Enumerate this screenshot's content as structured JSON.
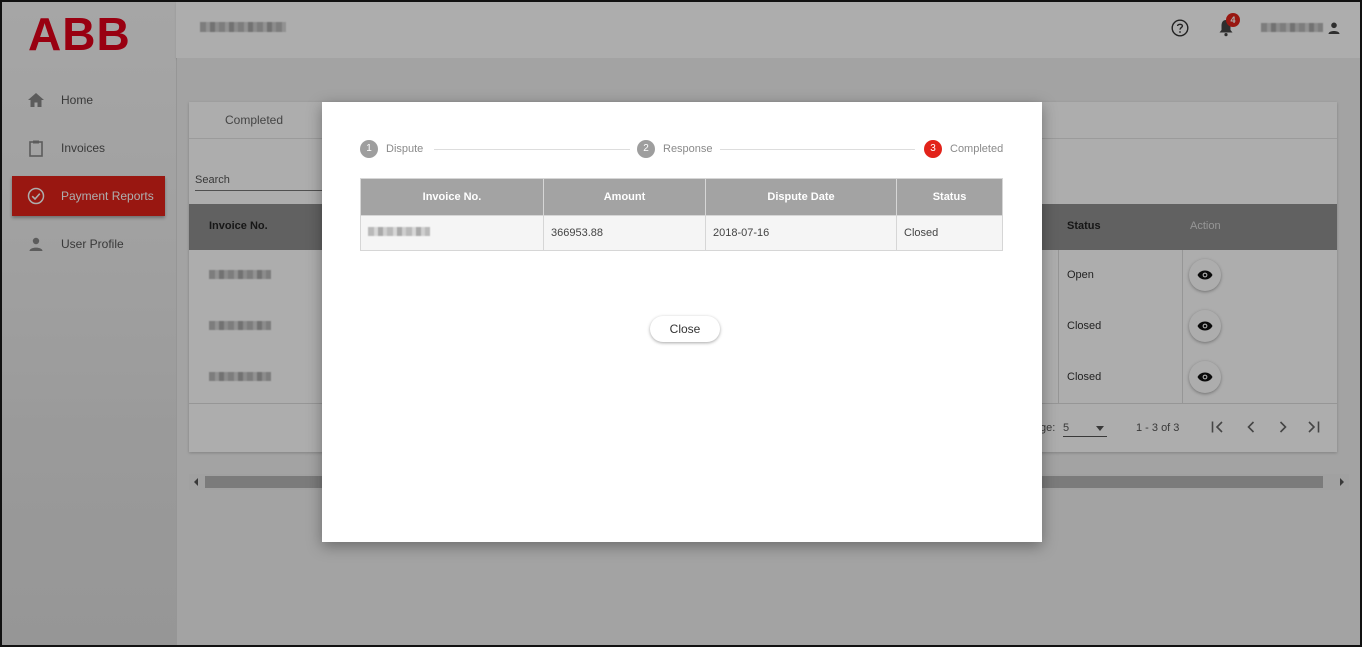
{
  "brand": {
    "logo_text": "ABB",
    "accent": "#e2231a"
  },
  "sidebar": {
    "items": [
      {
        "label": "Home",
        "icon": "home-icon"
      },
      {
        "label": "Invoices",
        "icon": "clipboard-icon"
      },
      {
        "label": "Payment Reports",
        "icon": "check-circle-icon",
        "active": true
      },
      {
        "label": "User Profile",
        "icon": "person-icon"
      }
    ]
  },
  "header": {
    "notification_count": "4"
  },
  "page": {
    "tab_label": "Completed",
    "search_placeholder": "Search",
    "table": {
      "columns": [
        "Invoice No.",
        "Status",
        "Action"
      ],
      "rows": [
        {
          "status": "Open"
        },
        {
          "status": "Closed"
        },
        {
          "status": "Closed"
        }
      ]
    },
    "pager": {
      "items_per_page_label": "ge:",
      "items_per_page": "5",
      "range": "1 - 3 of 3"
    }
  },
  "modal": {
    "steps": [
      {
        "num": "1",
        "label": "Dispute"
      },
      {
        "num": "2",
        "label": "Response"
      },
      {
        "num": "3",
        "label": "Completed"
      }
    ],
    "table": {
      "columns": [
        "Invoice No.",
        "Amount",
        "Dispute Date",
        "Status"
      ],
      "rows": [
        {
          "amount": "366953.88",
          "dispute_date": "2018-07-16",
          "status": "Closed"
        }
      ]
    },
    "close_label": "Close"
  }
}
